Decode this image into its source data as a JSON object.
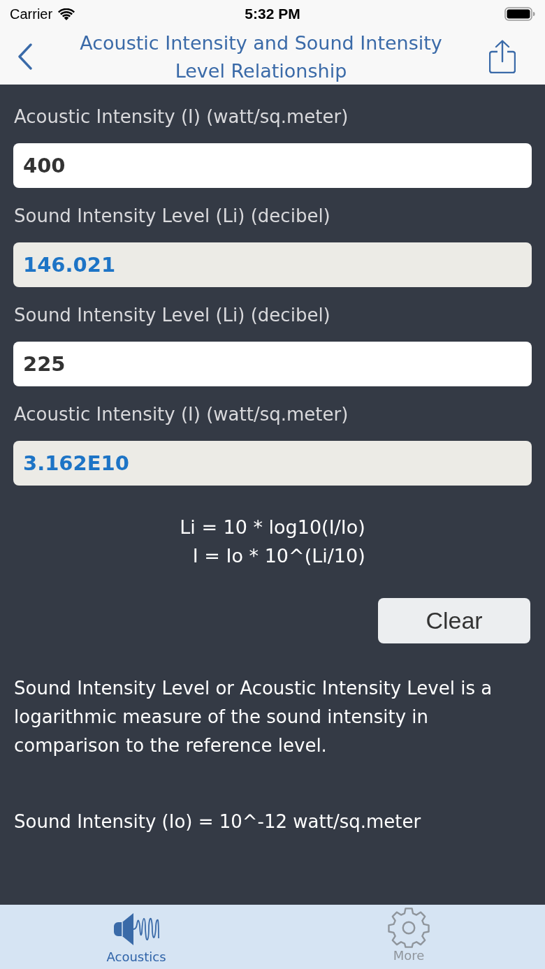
{
  "status_bar": {
    "carrier": "Carrier",
    "time": "5:32 PM"
  },
  "nav_bar": {
    "title": "Acoustic Intensity and Sound Intensity Level Relationship"
  },
  "fields": [
    {
      "label": "Acoustic Intensity (I) (watt/sq.meter)",
      "value": "400",
      "kind": "input"
    },
    {
      "label": "Sound Intensity Level (Li) (decibel)",
      "value": "146.021",
      "kind": "result"
    },
    {
      "label": "Sound Intensity Level (Li) (decibel)",
      "value": "225",
      "kind": "input"
    },
    {
      "label": "Acoustic Intensity (I) (watt/sq.meter)",
      "value": "3.162E10",
      "kind": "result"
    }
  ],
  "formulas": [
    "Li = 10 * log10(I/Io)",
    "I = Io * 10^(Li/10)"
  ],
  "clear_button": "Clear",
  "description": "Sound Intensity Level or Acoustic Intensity Level is a logarithmic measure of the sound intensity in comparison to the reference level.",
  "reference": "Sound Intensity (Io) = 10^-12 watt/sq.meter",
  "tab_bar": [
    {
      "label": "Acoustics",
      "selected": true,
      "kind": "acoustics"
    },
    {
      "label": "More",
      "selected": false,
      "kind": "more"
    }
  ]
}
